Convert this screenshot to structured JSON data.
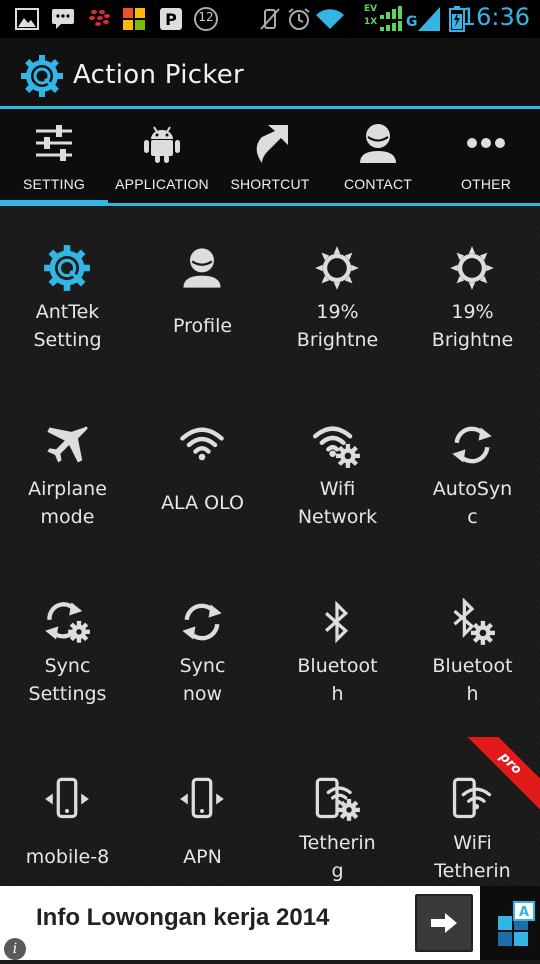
{
  "status_bar": {
    "time": "16:36",
    "notification_badge": "12",
    "network_label": "G",
    "ev_label": "EV",
    "onex_label": "1X"
  },
  "action_bar": {
    "title": "Action Picker"
  },
  "tabs": [
    {
      "label": "SETTING",
      "icon": "sliders-icon",
      "active": true
    },
    {
      "label": "APPLICATION",
      "icon": "android-icon",
      "active": false
    },
    {
      "label": "SHORTCUT",
      "icon": "shortcut-arrow-icon",
      "active": false
    },
    {
      "label": "CONTACT",
      "icon": "contact-person-icon",
      "active": false
    },
    {
      "label": "OTHER",
      "icon": "more-dots-icon",
      "active": false
    }
  ],
  "grid": [
    {
      "line1": "AntTek",
      "line2": "Setting",
      "icon": "anttek-gear-icon"
    },
    {
      "line1": "Profile",
      "line2": "",
      "icon": "profile-icon"
    },
    {
      "line1": "19%",
      "line2": "Brightne",
      "icon": "brightness-icon"
    },
    {
      "line1": "19%",
      "line2": "Brightne",
      "icon": "brightness-icon"
    },
    {
      "line1": "Airplane",
      "line2": "mode",
      "icon": "airplane-icon"
    },
    {
      "line1": "ALA OLO",
      "line2": "",
      "icon": "wifi-icon"
    },
    {
      "line1": "Wifi",
      "line2": "Network",
      "icon": "wifi-settings-icon"
    },
    {
      "line1": "AutoSyn",
      "line2": "c",
      "icon": "sync-icon"
    },
    {
      "line1": "Sync",
      "line2": "Settings",
      "icon": "sync-settings-icon"
    },
    {
      "line1": "Sync",
      "line2": "now",
      "icon": "sync-now-icon"
    },
    {
      "line1": "Bluetoot",
      "line2": "h",
      "icon": "bluetooth-icon"
    },
    {
      "line1": "Bluetoot",
      "line2": "h",
      "icon": "bluetooth-settings-icon"
    },
    {
      "line1": "mobile-8",
      "line2": "",
      "icon": "mobile-data-icon"
    },
    {
      "line1": "APN",
      "line2": "",
      "icon": "apn-icon"
    },
    {
      "line1": "Tetherin",
      "line2": "g",
      "icon": "tethering-icon"
    },
    {
      "line1": "WiFi",
      "line2": "Tetherin",
      "icon": "wifi-tethering-icon",
      "badge": "pro"
    }
  ],
  "ad": {
    "text": "Info Lowongan kerja 2014",
    "info": "i"
  },
  "colors": {
    "accent": "#33b5e5",
    "ribbon": "#e11a1a"
  }
}
